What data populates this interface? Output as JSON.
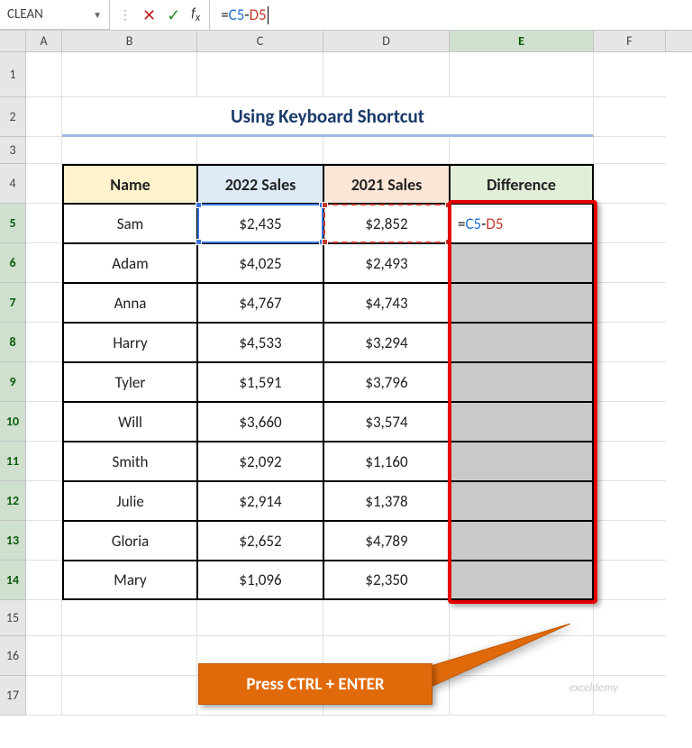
{
  "name_box": "CLEAN",
  "formula": {
    "eq": "=",
    "ref1": "C5",
    "dash": "-",
    "ref2": "D5"
  },
  "columns": [
    "A",
    "B",
    "C",
    "D",
    "E",
    "F"
  ],
  "rows": [
    1,
    2,
    3,
    4,
    5,
    6,
    7,
    8,
    9,
    10,
    11,
    12,
    13,
    14,
    15,
    16,
    17
  ],
  "title": "Using Keyboard Shortcut",
  "headers": {
    "name": "Name",
    "c2022": "2022 Sales",
    "c2021": "2021 Sales",
    "diff": "Difference"
  },
  "data": [
    {
      "name": "Sam",
      "c2022": "$2,435",
      "c2021": "$2,852"
    },
    {
      "name": "Adam",
      "c2022": "$4,025",
      "c2021": "$2,493"
    },
    {
      "name": "Anna",
      "c2022": "$4,767",
      "c2021": "$4,743"
    },
    {
      "name": "Harry",
      "c2022": "$4,533",
      "c2021": "$3,294"
    },
    {
      "name": "Tyler",
      "c2022": "$1,591",
      "c2021": "$3,796"
    },
    {
      "name": "Will",
      "c2022": "$3,660",
      "c2021": "$3,574"
    },
    {
      "name": "Smith",
      "c2022": "$2,092",
      "c2021": "$1,160"
    },
    {
      "name": "Julie",
      "c2022": "$2,914",
      "c2021": "$1,378"
    },
    {
      "name": "Gloria",
      "c2022": "$2,652",
      "c2021": "$4,789"
    },
    {
      "name": "Mary",
      "c2022": "$1,096",
      "c2021": "$2,350"
    }
  ],
  "e5_formula": {
    "eq": "=",
    "ref1": "C5",
    "dash": "-",
    "ref2": "D5"
  },
  "callout": "Press CTRL + ENTER",
  "watermark": "exceldemy"
}
